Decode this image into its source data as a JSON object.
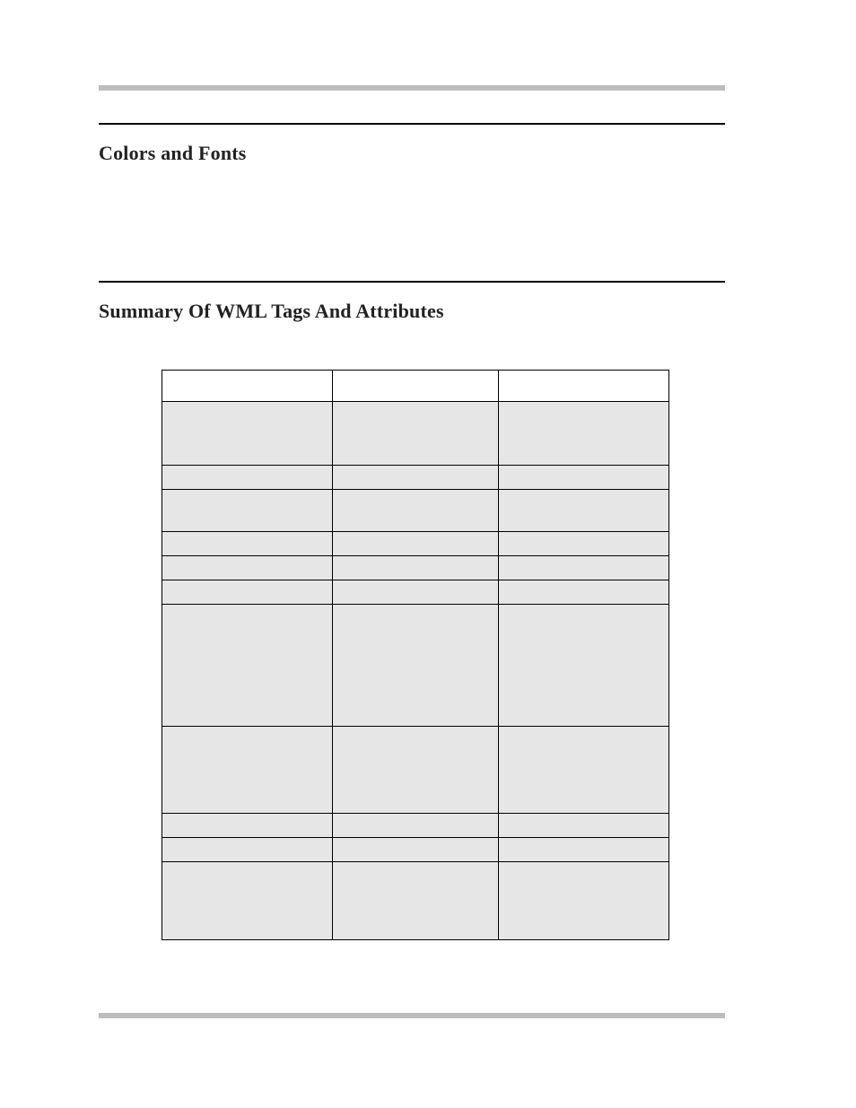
{
  "section1": {
    "title": "Colors and Fonts"
  },
  "section2": {
    "title": "Summary Of WML Tags And Attributes"
  },
  "table": {
    "headers": [
      "",
      "",
      ""
    ],
    "rows": [
      [
        "",
        "",
        ""
      ],
      [
        "",
        "",
        ""
      ],
      [
        "",
        "",
        ""
      ],
      [
        "",
        "",
        ""
      ],
      [
        "",
        "",
        ""
      ],
      [
        "",
        "",
        ""
      ],
      [
        "",
        "",
        ""
      ],
      [
        "",
        "",
        ""
      ],
      [
        "",
        "",
        ""
      ],
      [
        "",
        "",
        ""
      ],
      [
        "",
        "",
        ""
      ]
    ]
  }
}
